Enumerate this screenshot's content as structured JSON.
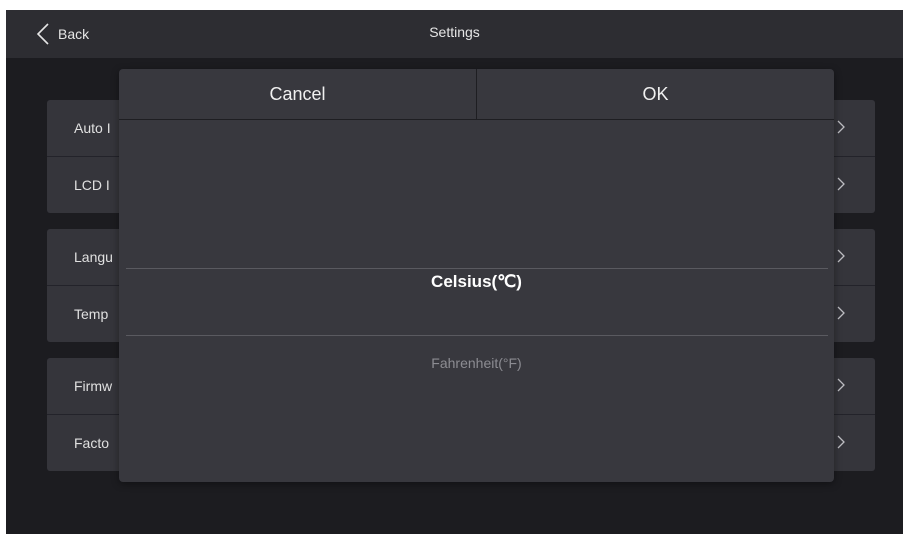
{
  "header": {
    "back_label": "Back",
    "title": "Settings",
    "back_icon": "chevron-left-icon"
  },
  "settings": {
    "groups": [
      {
        "items": [
          {
            "label": "Auto I"
          },
          {
            "label": "LCD I"
          }
        ]
      },
      {
        "items": [
          {
            "label": "Langu"
          },
          {
            "label": "Temp"
          }
        ]
      },
      {
        "items": [
          {
            "label": "Firmw"
          },
          {
            "label": "Facto"
          }
        ]
      }
    ],
    "chevron_icon": "chevron-right-icon"
  },
  "dialog": {
    "cancel_label": "Cancel",
    "ok_label": "OK",
    "options": {
      "selected": "Celsius(℃)",
      "other": "Fahrenheit(°F)"
    }
  },
  "colors": {
    "background": "#1c1c20",
    "topbar": "#2d2d32",
    "panel": "#35353b",
    "dialog": "#38383e",
    "text": "#e6e6e6",
    "muted_text": "#8c8c92"
  }
}
